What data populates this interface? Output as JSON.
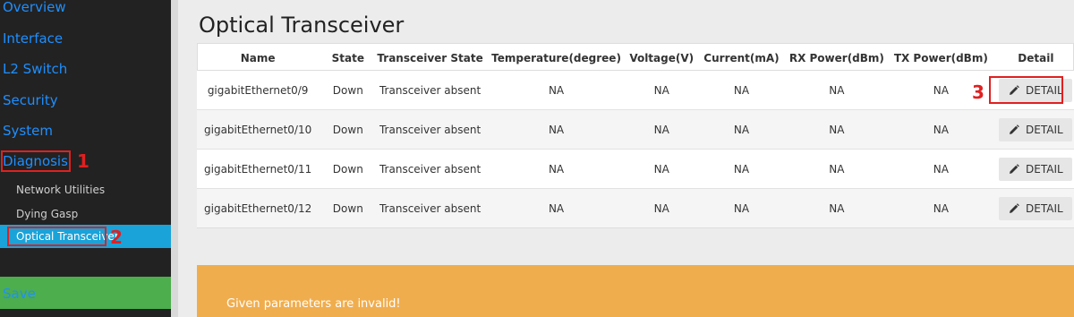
{
  "sidebar": {
    "items": [
      {
        "label": "Overview"
      },
      {
        "label": "Interface"
      },
      {
        "label": "L2 Switch"
      },
      {
        "label": "Security"
      },
      {
        "label": "System"
      },
      {
        "label": "Diagnosis"
      }
    ],
    "sub_items": [
      {
        "label": "Network Utilities"
      },
      {
        "label": "Dying Gasp"
      },
      {
        "label": "Optical Transceiver"
      }
    ],
    "save_label": "Save",
    "link_color": "#1e8fff",
    "active_color": "#1aa3d9",
    "save_color": "#4cae4c"
  },
  "annotations": {
    "step1": "1",
    "step2": "2",
    "step3": "3"
  },
  "main": {
    "title": "Optical Transceiver",
    "table": {
      "headers": [
        "Name",
        "State",
        "Transceiver State",
        "Temperature(degree)",
        "Voltage(V)",
        "Current(mA)",
        "RX Power(dBm)",
        "TX Power(dBm)",
        "Detail"
      ],
      "rows": [
        {
          "name": "gigabitEthernet0/9",
          "state": "Down",
          "transceiver_state": "Transceiver absent",
          "temperature": "NA",
          "voltage": "NA",
          "current": "NA",
          "rx_power": "NA",
          "tx_power": "NA"
        },
        {
          "name": "gigabitEthernet0/10",
          "state": "Down",
          "transceiver_state": "Transceiver absent",
          "temperature": "NA",
          "voltage": "NA",
          "current": "NA",
          "rx_power": "NA",
          "tx_power": "NA"
        },
        {
          "name": "gigabitEthernet0/11",
          "state": "Down",
          "transceiver_state": "Transceiver absent",
          "temperature": "NA",
          "voltage": "NA",
          "current": "NA",
          "rx_power": "NA",
          "tx_power": "NA"
        },
        {
          "name": "gigabitEthernet0/12",
          "state": "Down",
          "transceiver_state": "Transceiver absent",
          "temperature": "NA",
          "voltage": "NA",
          "current": "NA",
          "rx_power": "NA",
          "tx_power": "NA"
        }
      ],
      "detail_label": "DETAIL",
      "detail_icon": "pencil-icon"
    },
    "alert": {
      "text": "Given parameters are invalid!",
      "color": "#f0ad4e"
    }
  }
}
